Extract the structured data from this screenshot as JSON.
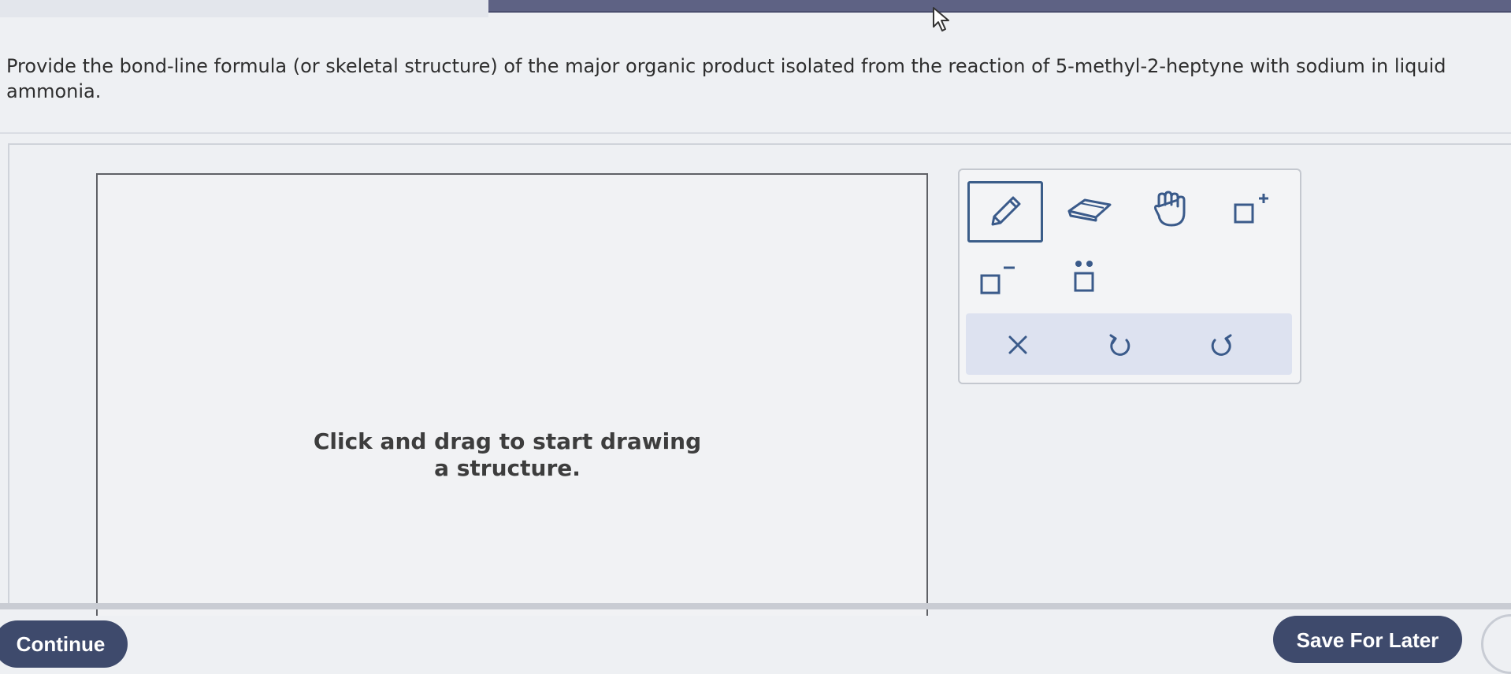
{
  "question": {
    "text": "Provide the bond-line formula (or skeletal structure) of the major organic product isolated from the reaction of 5-methyl-2-heptyne with sodium in liquid ammonia."
  },
  "canvas": {
    "hint": "Click and drag to start drawing a structure."
  },
  "toolbar": {
    "tools": [
      "pencil-icon",
      "eraser-icon",
      "hand-icon",
      "positive-charge-icon",
      "negative-charge-icon",
      "lone-pair-icon"
    ],
    "actions": [
      "clear-icon",
      "undo-icon",
      "redo-icon"
    ],
    "colors": {
      "selected_border": "#3b5d89",
      "action_bar": "#dde2f0",
      "icon": "#3a5a8a"
    }
  },
  "footer": {
    "continue_label": "Continue",
    "save_label": "Save For Later",
    "button_color": "#3e4a6c"
  }
}
